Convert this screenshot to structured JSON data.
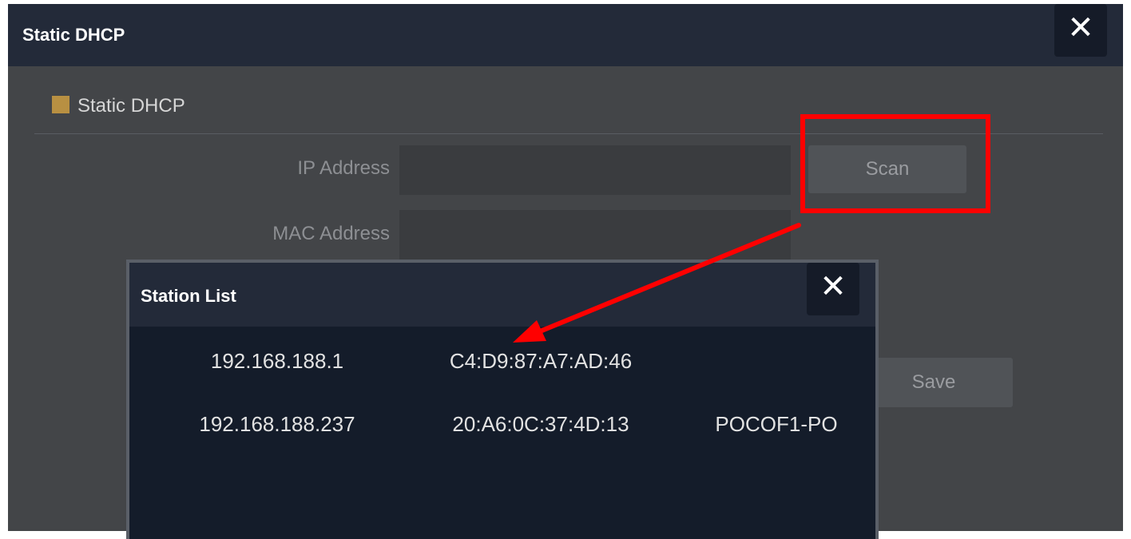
{
  "dialog": {
    "title": "Static DHCP",
    "close_icon": "close-icon"
  },
  "section": {
    "title": "Static DHCP",
    "accent_color": "#b89042"
  },
  "form": {
    "ip_label": "IP Address",
    "ip_value": "",
    "mac_label": "MAC Address",
    "mac_value": "",
    "scan_label": "Scan",
    "save_label": "Save"
  },
  "annotation": {
    "color": "#ff0000"
  },
  "station_list": {
    "title": "Station List",
    "close_icon": "close-icon",
    "rows": [
      {
        "ip": "192.168.188.1",
        "mac": "C4:D9:87:A7:AD:46",
        "name": ""
      },
      {
        "ip": "192.168.188.237",
        "mac": "20:A6:0C:37:4D:13",
        "name": "POCOF1-PO"
      }
    ]
  }
}
